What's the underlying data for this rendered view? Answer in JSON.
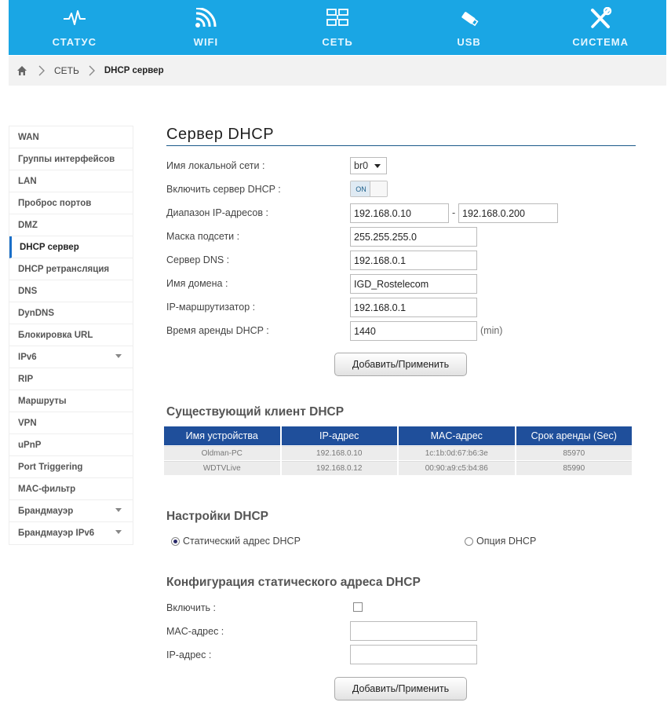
{
  "nav": {
    "items": [
      {
        "label": "СТАТУС",
        "icon": "pulse-icon"
      },
      {
        "label": "WIFI",
        "icon": "wifi-icon"
      },
      {
        "label": "СЕТЬ",
        "icon": "network-icon"
      },
      {
        "label": "USB",
        "icon": "usb-icon"
      },
      {
        "label": "СИСТЕМА",
        "icon": "tools-icon"
      }
    ]
  },
  "breadcrumb": {
    "items": [
      "СЕТЬ",
      "DHCP сервер"
    ]
  },
  "sidebar": {
    "items": [
      {
        "label": "WAN"
      },
      {
        "label": "Группы интерфейсов"
      },
      {
        "label": "LAN"
      },
      {
        "label": "Проброс портов"
      },
      {
        "label": "DMZ"
      },
      {
        "label": "DHCP сервер",
        "active": true
      },
      {
        "label": "DHCP ретрансляция"
      },
      {
        "label": "DNS"
      },
      {
        "label": "DynDNS"
      },
      {
        "label": "Блокировка URL"
      },
      {
        "label": "IPv6",
        "expandable": true
      },
      {
        "label": "RIP"
      },
      {
        "label": "Маршруты"
      },
      {
        "label": "VPN"
      },
      {
        "label": "uPnP"
      },
      {
        "label": "Port Triggering"
      },
      {
        "label": "MAC-фильтр"
      },
      {
        "label": "Брандмауэр",
        "expandable": true
      },
      {
        "label": "Брандмауэр IPv6",
        "expandable": true
      }
    ]
  },
  "dhcp": {
    "title": "Сервер DHCP",
    "lan_name_label": "Имя локальной сети :",
    "lan_name_value": "br0",
    "enable_label": "Включить сервер DHCP :",
    "enable_value": "ON",
    "range_label": "Диапазон IP-адресов :",
    "range_start": "192.168.0.10",
    "range_sep": "-",
    "range_end": "192.168.0.200",
    "mask_label": "Маска подсети :",
    "mask_value": "255.255.255.0",
    "dns_label": "Сервер DNS :",
    "dns_value": "192.168.0.1",
    "domain_label": "Имя домена :",
    "domain_value": "IGD_Rostelecom",
    "router_label": "IP-маршрутизатор :",
    "router_value": "192.168.0.1",
    "lease_label": "Время аренды DHCP :",
    "lease_value": "1440",
    "lease_unit": "(min)",
    "apply_label": "Добавить/Применить"
  },
  "clients": {
    "title": "Существующий клиент DHCP",
    "headers": [
      "Имя устройства",
      "IP-адрес",
      "MAC-адрес",
      "Срок аренды (Sec)"
    ],
    "rows": [
      [
        "Oldman-PC",
        "192.168.0.10",
        "1c:1b:0d:67:b6:3e",
        "85970"
      ],
      [
        "WDTVLive",
        "192.168.0.12",
        "00:90:a9:c5:b4:86",
        "85990"
      ]
    ]
  },
  "settings": {
    "title": "Настройки DHCP",
    "static_label": "Статический адрес DHCP",
    "static_checked": true,
    "option_label": "Опция DHCP",
    "option_checked": false
  },
  "static_config": {
    "title": "Конфигурация статического адреса DHCP",
    "enable_label": "Включить :",
    "mac_label": "MAC-адрес :",
    "ip_label": "IP-адрес :",
    "mac_value": "",
    "ip_value": "",
    "apply_label": "Добавить/Применить"
  },
  "colors": {
    "nav_bg": "#1aa6e4",
    "table_header": "#1f4f9b"
  }
}
